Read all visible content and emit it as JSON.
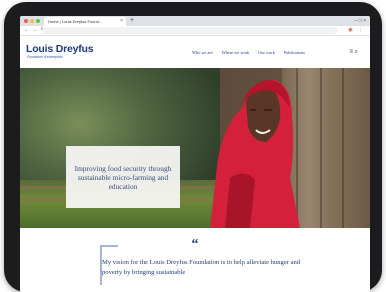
{
  "browser": {
    "tab_title": "Home | Louis Dreyfus Found...",
    "tab_close": "×",
    "new_tab": "+",
    "window_controls": "–  □  ×",
    "nav_buttons": "← → ↻",
    "url": "",
    "extensions": "◉ ⋮"
  },
  "site": {
    "logo_title": "Louis Dreyfus",
    "logo_subtitle": "Fondation d'entreprise",
    "nav": [
      "Who we are",
      "Where we work",
      "Our work",
      "Publications"
    ],
    "menu_icon": "≡ ⌕"
  },
  "hero": {
    "caption": "Improving food security through sustainable micro-farming and education"
  },
  "quote": {
    "mark": "“",
    "text": "My vision for the Louis Dreyfus Foundation is to help alleviate hunger and poverty by bringing sustainable"
  },
  "colors": {
    "brand_blue": "#1f3c7a",
    "accent_blue": "#2a5aa8",
    "scarf_red": "#d4203a"
  }
}
